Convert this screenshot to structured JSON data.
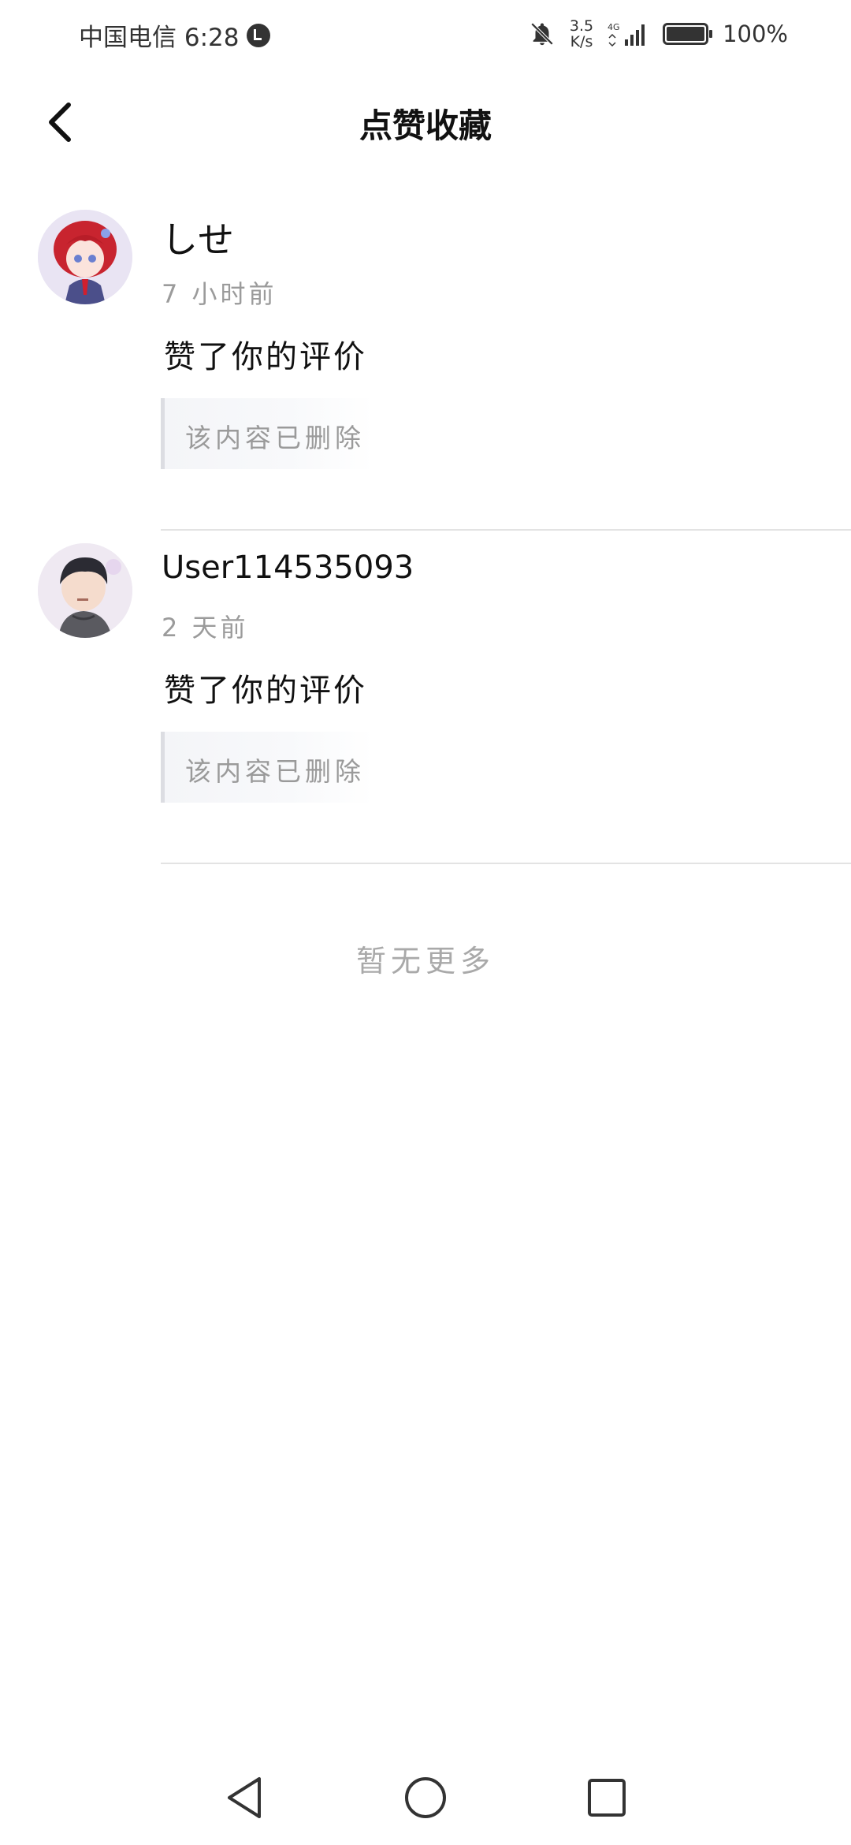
{
  "status_bar": {
    "carrier_time": "中国电信 6:28",
    "net_speed_value": "3.5",
    "net_speed_unit": "K/s",
    "network_type": "4G",
    "battery_percent": "100%",
    "icons": [
      "alarm-icon",
      "bell-off-icon",
      "signal-icon",
      "battery-icon"
    ]
  },
  "header": {
    "title": "点赞收藏",
    "back_icon": "chevron-left-icon"
  },
  "notifications": [
    {
      "user_name": "しせ",
      "time": "7 小时前",
      "action": "赞了你的评价",
      "quoted_content": "该内容已删除",
      "avatar": "avatar-red-hair-girl"
    },
    {
      "user_name": "User114535093",
      "time": "2 天前",
      "action": "赞了你的评价",
      "quoted_content": "该内容已删除",
      "avatar": "avatar-dark-hair-boy"
    }
  ],
  "footer_text": "暂无更多",
  "nav_bar": {
    "icons": [
      "nav-back-icon",
      "nav-home-icon",
      "nav-recent-icon"
    ]
  },
  "colors": {
    "text_primary": "#111111",
    "text_secondary": "#9b9b9b",
    "divider": "#e3e3e3",
    "quote_border": "#dcdde2",
    "quote_bg": "#f4f5f8"
  }
}
